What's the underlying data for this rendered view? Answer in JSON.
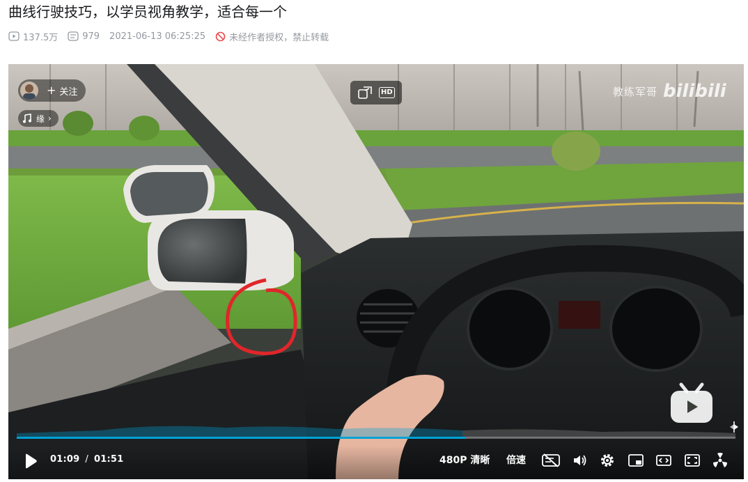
{
  "video": {
    "title": "曲线行驶技巧，以学员视角教学，适合每一个",
    "views": "137.5万",
    "danmaku": "979",
    "date": "2021-06-13 06:25:25",
    "copyright": "未经作者授权，禁止转载"
  },
  "overlay": {
    "follow_label": "关注",
    "music_label": "缘",
    "watermark_text": "教练军哥",
    "watermark_brand": "bilibili",
    "hd_label": "HD"
  },
  "player": {
    "current_time": "01:09",
    "time_separator": "/",
    "duration": "01:51",
    "progress_fraction": 0.625,
    "quality_label": "480P 清晰",
    "speed_label": "倍速",
    "accent_color": "#00a1d6"
  },
  "icons": {
    "play": "play-icon",
    "danmaku_toggle": "danmaku-off-icon",
    "volume": "volume-icon",
    "settings": "gear-icon",
    "pip": "picture-in-picture-icon",
    "wide": "widescreen-icon",
    "web_fullscreen": "web-fullscreen-icon",
    "fullscreen": "fullscreen-icon"
  }
}
